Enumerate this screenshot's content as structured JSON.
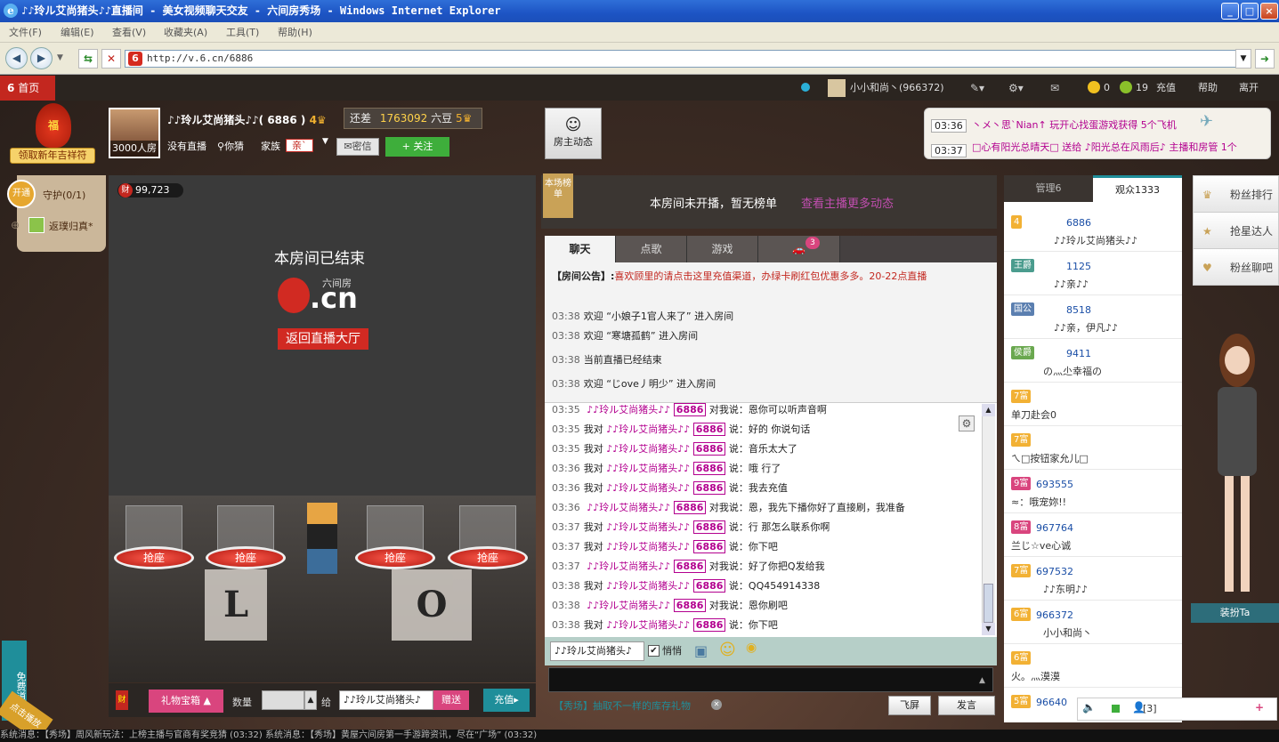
{
  "window": {
    "title": "♪♪玲ル艾尚猪头♪♪直播间 - 美女视频聊天交友 - 六间房秀场 - Windows Internet Explorer",
    "min": "_",
    "max": "□",
    "close": "×"
  },
  "menu": [
    "文件(F)",
    "编辑(E)",
    "查看(V)",
    "收藏夹(A)",
    "工具(T)",
    "帮助(H)"
  ],
  "address": {
    "url": "http://v.6.cn/6886",
    "logo": "6"
  },
  "site": {
    "home": "首页",
    "user": "小小和尚丶(966372)",
    "coins": "0",
    "beans": "19",
    "recharge": "充值",
    "help": "帮助",
    "leave": "离开"
  },
  "host": {
    "name": "♪♪玲ル艾尚猪头♪♪",
    "room_id": "6886",
    "level": "4",
    "still": "还差",
    "points": "1763092",
    "beans_label": "六豆",
    "next_level": "5",
    "room_size": "3000人房",
    "not_live": "没有直播",
    "location": "你猜",
    "family_label": "家族",
    "family": "亲`",
    "msg_btn": "密信",
    "follow_btn": "+ 关注",
    "dynamic_btn": "房主动态"
  },
  "promo": {
    "lucky": "领取新年吉祥符",
    "bag": "福"
  },
  "guard": {
    "open": "开通",
    "label": "守护(0/1)",
    "member": "返璞归真*"
  },
  "video": {
    "wealth": "99,723",
    "ended": "本房间已结束",
    "brand_cn": "六间房",
    "brand": ".cn",
    "back_btn": "返回直播大厅"
  },
  "seats": [
    "抢座",
    "抢座",
    "抢座",
    "抢座"
  ],
  "rank": {
    "badge": "本场榜单",
    "text": "本房间未开播，暂无榜单",
    "link": "查看主播更多动态"
  },
  "tabs": [
    {
      "label": "聊天"
    },
    {
      "label": "点歌"
    },
    {
      "label": "游戏"
    },
    {
      "label": "🚗",
      "badge": "3"
    }
  ],
  "announce": {
    "label": "【房间公告】:",
    "text": "喜欢顾里的请点击这里充值渠道，办绿卡刷红包优惠多多。20-22点直播"
  },
  "system": [
    {
      "time": "03:38",
      "text": "欢迎 “小娘子1官人来了” 进入房间"
    },
    {
      "time": "03:38",
      "text": "欢迎 “寒塘孤鹤” 进入房间"
    },
    {
      "time": "03:38",
      "text": "当前直播已经结束"
    },
    {
      "time": "03:38",
      "text": "欢迎 “じove丿明少” 进入房间"
    }
  ],
  "chat": [
    {
      "time": "03:35",
      "pre": "",
      "nick": "♪♪玲ル艾尚猪头♪♪",
      "uid": "6886",
      "msg": "对我说：恩你可以听声音啊"
    },
    {
      "time": "03:35",
      "pre": "我对",
      "nick": "♪♪玲ル艾尚猪头♪♪",
      "uid": "6886",
      "msg": "说：好的 你说句话"
    },
    {
      "time": "03:35",
      "pre": "我对",
      "nick": "♪♪玲ル艾尚猪头♪♪",
      "uid": "6886",
      "msg": "说：音乐太大了"
    },
    {
      "time": "03:36",
      "pre": "我对",
      "nick": "♪♪玲ル艾尚猪头♪♪",
      "uid": "6886",
      "msg": "说：哦 行了"
    },
    {
      "time": "03:36",
      "pre": "我对",
      "nick": "♪♪玲ル艾尚猪头♪♪",
      "uid": "6886",
      "msg": "说：我去充值"
    },
    {
      "time": "03:36",
      "pre": "",
      "nick": "♪♪玲ル艾尚猪头♪♪",
      "uid": "6886",
      "msg": "对我说：恩，我先下播你好了直接刷，我准备"
    },
    {
      "time": "03:37",
      "pre": "我对",
      "nick": "♪♪玲ル艾尚猪头♪♪",
      "uid": "6886",
      "msg": "说：行 那怎么联系你啊"
    },
    {
      "time": "03:37",
      "pre": "我对",
      "nick": "♪♪玲ル艾尚猪头♪♪",
      "uid": "6886",
      "msg": "说：你下吧"
    },
    {
      "time": "03:37",
      "pre": "",
      "nick": "♪♪玲ル艾尚猪头♪♪",
      "uid": "6886",
      "msg": "对我说：好了你把Q发给我"
    },
    {
      "time": "03:38",
      "pre": "我对",
      "nick": "♪♪玲ル艾尚猪头♪♪",
      "uid": "6886",
      "msg": "说：QQ454914338"
    },
    {
      "time": "03:38",
      "pre": "",
      "nick": "♪♪玲ル艾尚猪头♪♪",
      "uid": "6886",
      "msg": "对我说：恩你刷吧"
    },
    {
      "time": "03:38",
      "pre": "我对",
      "nick": "♪♪玲ル艾尚猪头♪♪",
      "uid": "6886",
      "msg": "说：你下吧"
    }
  ],
  "input": {
    "target": "♪♪玲ル艾尚猪头♪",
    "whisper": "悄悄",
    "show_tip": "【秀场】抽取不一样的库存礼物",
    "fly_btn": "飞屏",
    "send_btn": "发言"
  },
  "gift": {
    "box_btn": "礼物宝箱",
    "qty_label": "数量",
    "to_label": "给",
    "to_user": "♪♪玲ル艾尚猪头♪",
    "give_btn": "赠送",
    "recharge_btn": "充值"
  },
  "feed": [
    {
      "time": "03:36",
      "text": "丶メ丶思`Nian↑ 玩开心找蛋游戏获得 5个飞机"
    },
    {
      "time": "03:37",
      "text": "□心有阳光总晴天□ 送给 ♪阳光总在风雨后♪ 主播和房管 1个"
    }
  ],
  "audience": {
    "tab_admin": "管理6",
    "tab_viewers": "观众1333",
    "rows": [
      {
        "level": "4",
        "id": "6886",
        "name": "♪♪玲ル艾尚猪头♪♪"
      },
      {
        "level": "王爵",
        "id": "1125",
        "name": "♪♪亲♪♪"
      },
      {
        "level": "国公",
        "id": "8518",
        "name": "♪♪亲，伊凡♪♪"
      },
      {
        "level": "侯爵",
        "id": "9411",
        "name": "の灬尐幸福の"
      },
      {
        "level": "7富",
        "id": "",
        "name": "单刀赴会0"
      },
      {
        "level": "7富",
        "id": "",
        "name": "ㄟ□按钮家允儿□"
      },
      {
        "level": "9富",
        "id": "693555",
        "name": "≈：哦宠妳!!"
      },
      {
        "level": "8富",
        "id": "967764",
        "name": "兰じ☆ve心诚"
      },
      {
        "level": "7富",
        "id": "697532",
        "name": "♪♪东明♪♪"
      },
      {
        "level": "6富",
        "id": "966372",
        "name": "小小和尚丶"
      },
      {
        "level": "6富",
        "id": "",
        "name": "火。灬漠漠"
      },
      {
        "level": "5富",
        "id": "96640",
        "name": ""
      }
    ],
    "count": "[3]"
  },
  "side": {
    "fans_rank": "粉丝排行",
    "star": "抢星达人",
    "fans_chat": "粉丝聊吧",
    "dress": "装扮Ta"
  },
  "tools": {
    "free": "免费道具",
    "replay": "点击播放"
  },
  "ticker": "系统消息：【秀场】周风新玩法：上榜主播与官商有奖竞猜 (03:32)        系统消息：【秀场】黄屋六间房第一手游蹄资讯，尽在“广场” (03:32)"
}
